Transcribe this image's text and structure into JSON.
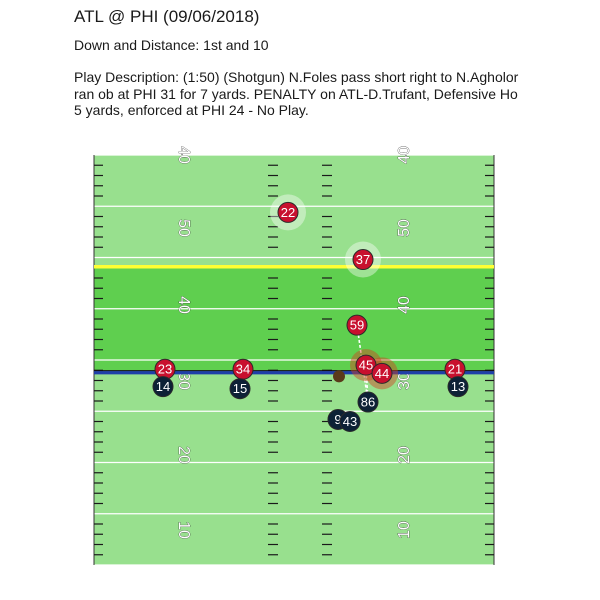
{
  "title": "ATL @ PHI (09/06/2018)",
  "down_distance": "Down and Distance: 1st and 10",
  "description_lines": [
    "Play Description: (1:50) (Shotgun) N.Foles pass short right to N.Agholor",
    "ran ob at PHI 31 for 7 yards. PENALTY on ATL-D.Trufant, Defensive Ho",
    "5 yards, enforced at PHI 24 - No Play."
  ],
  "colors": {
    "field_light": "#98e08e",
    "field_dark": "#5fcf4f",
    "line_of_scrimmage": "#1f3fa8",
    "first_down_line": "#ffff33",
    "offense": "#c8102e",
    "defense": "#0d2136",
    "ball": "#5a3a1a",
    "track": "#ffffff",
    "halo": "#d04020"
  },
  "chart_data": {
    "type": "scatter",
    "yard_range": [
      5,
      45
    ],
    "line_of_scrimmage_yard": 24,
    "first_down_yard": 34,
    "yard_numbers": [
      "40",
      "50",
      "40",
      "30",
      "20",
      "10"
    ],
    "yard_number_values": [
      40,
      50,
      40,
      30,
      20,
      10
    ],
    "yard_number_yards": [
      45,
      35,
      25,
      15
    ],
    "team_offense": "PHI",
    "team_defense": "ATL",
    "players": [
      {
        "jersey": "22",
        "team": "offense",
        "x": 19.4,
        "y": 39.4,
        "halo": "light"
      },
      {
        "jersey": "37",
        "team": "offense",
        "x": 26.9,
        "y": 34.8,
        "halo": "light"
      },
      {
        "jersey": "59",
        "team": "offense",
        "x": 26.3,
        "y": 28.4,
        "halo": "none"
      },
      {
        "jersey": "45",
        "team": "offense",
        "x": 27.2,
        "y": 24.5,
        "halo": "red"
      },
      {
        "jersey": "44",
        "team": "offense",
        "x": 28.8,
        "y": 23.7,
        "halo": "red"
      },
      {
        "jersey": "23",
        "team": "offense",
        "x": 7.1,
        "y": 24.1,
        "halo": "none"
      },
      {
        "jersey": "34",
        "team": "offense",
        "x": 14.9,
        "y": 24.1,
        "halo": "none"
      },
      {
        "jersey": "21",
        "team": "offense",
        "x": 36.1,
        "y": 24.1,
        "halo": "none"
      },
      {
        "jersey": "14",
        "team": "defense",
        "x": 6.9,
        "y": 22.4,
        "halo": "none"
      },
      {
        "jersey": "15",
        "team": "defense",
        "x": 14.6,
        "y": 22.2,
        "halo": "none"
      },
      {
        "jersey": "13",
        "team": "defense",
        "x": 36.4,
        "y": 22.4,
        "halo": "none"
      },
      {
        "jersey": "86",
        "team": "defense",
        "x": 27.4,
        "y": 20.9,
        "halo": "none"
      },
      {
        "jersey": "9",
        "team": "defense",
        "x": 24.4,
        "y": 19.2,
        "halo": "none"
      },
      {
        "jersey": "43",
        "team": "defense",
        "x": 25.6,
        "y": 19.0,
        "halo": "none"
      }
    ],
    "ball": {
      "x": 24.5,
      "y": 23.4
    }
  }
}
